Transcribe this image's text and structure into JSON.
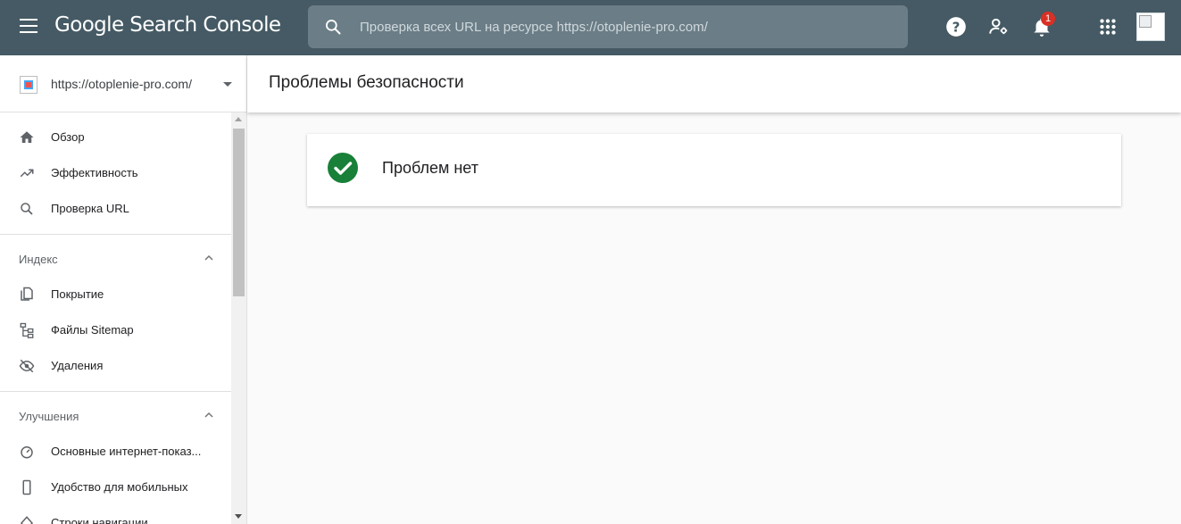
{
  "app": {
    "title_google": "Google",
    "title_product": "Search Console"
  },
  "search": {
    "placeholder": "Проверка всех URL на ресурсе https://otoplenie-pro.com/"
  },
  "notifications": {
    "count": "1"
  },
  "property": {
    "url": "https://otoplenie-pro.com/"
  },
  "sidebar": {
    "items_top": [
      {
        "label": "Обзор",
        "icon": "home-icon"
      },
      {
        "label": "Эффективность",
        "icon": "trending-up-icon"
      },
      {
        "label": "Проверка URL",
        "icon": "search-icon"
      }
    ],
    "index": {
      "header": "Индекс",
      "items": [
        {
          "label": "Покрытие",
          "icon": "copy-pages-icon"
        },
        {
          "label": "Файлы Sitemap",
          "icon": "sitemap-icon"
        },
        {
          "label": "Удаления",
          "icon": "eye-off-icon"
        }
      ]
    },
    "enhancements": {
      "header": "Улучшения",
      "items": [
        {
          "label": "Основные интернет-показ...",
          "icon": "speed-gauge-icon"
        },
        {
          "label": "Удобство для мобильных",
          "icon": "mobile-phone-icon"
        },
        {
          "label": "Строки навигации",
          "icon": "breadcrumb-diamond-icon"
        }
      ]
    }
  },
  "main": {
    "title": "Проблемы безопасности",
    "status_text": "Проблем нет"
  },
  "colors": {
    "topbar": "#455a64",
    "success": "#188038",
    "badge": "#d93025"
  }
}
